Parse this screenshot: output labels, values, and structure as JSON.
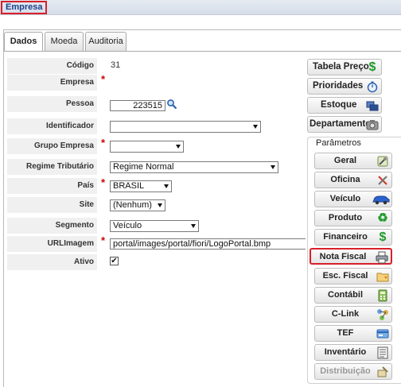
{
  "header": {
    "title": "Empresa"
  },
  "tabs": [
    {
      "label": "Dados",
      "active": true
    },
    {
      "label": "Moeda",
      "active": false
    },
    {
      "label": "Auditoria",
      "active": false
    }
  ],
  "form": {
    "codigo": {
      "label": "Código",
      "value": "31"
    },
    "empresa": {
      "label": "Empresa",
      "value": ""
    },
    "pessoa": {
      "label": "Pessoa",
      "value": "223515"
    },
    "identificador": {
      "label": "Identificador",
      "value": ""
    },
    "grupo_empresa": {
      "label": "Grupo Empresa",
      "value": ""
    },
    "regime_tributario": {
      "label": "Regime Tributário",
      "value": "Regime Normal"
    },
    "pais": {
      "label": "País",
      "value": "BRASIL"
    },
    "site": {
      "label": "Site",
      "value": "(Nenhum)"
    },
    "segmento": {
      "label": "Segmento",
      "value": "Veículo"
    },
    "url_imagem": {
      "label": "URLImagem",
      "value": "portal/images/portal/fiori/LogoPortal.bmp"
    },
    "ativo": {
      "label": "Ativo",
      "checked": true
    }
  },
  "side_buttons": [
    {
      "label": "Tabela Preço",
      "icon": "dollar-icon"
    },
    {
      "label": "Prioridades",
      "icon": "stopwatch-icon"
    },
    {
      "label": "Estoque",
      "icon": "stack-icon"
    },
    {
      "label": "Departamento",
      "icon": "camera-icon"
    }
  ],
  "parametros": {
    "title": "Parâmetros",
    "buttons": [
      {
        "label": "Geral",
        "icon": "tools-icon"
      },
      {
        "label": "Oficina",
        "icon": "wrench-icon"
      },
      {
        "label": "Veículo",
        "icon": "car-icon"
      },
      {
        "label": "Produto",
        "icon": "recycle-icon"
      },
      {
        "label": "Financeiro",
        "icon": "dollar-icon"
      },
      {
        "label": "Nota Fiscal",
        "icon": "printer-icon",
        "highlighted": true
      },
      {
        "label": "Esc. Fiscal",
        "icon": "folder-icon"
      },
      {
        "label": "Contábil",
        "icon": "calculator-icon"
      },
      {
        "label": "C-Link",
        "icon": "network-icon"
      },
      {
        "label": "TEF",
        "icon": "card-icon"
      },
      {
        "label": "Inventário",
        "icon": "list-icon"
      },
      {
        "label": "Distribuição",
        "icon": "distribution-icon",
        "disabled": true
      }
    ]
  },
  "colors": {
    "accent_red": "#d8202a",
    "title_blue": "#1c3f8a",
    "required": "#cc0000"
  }
}
